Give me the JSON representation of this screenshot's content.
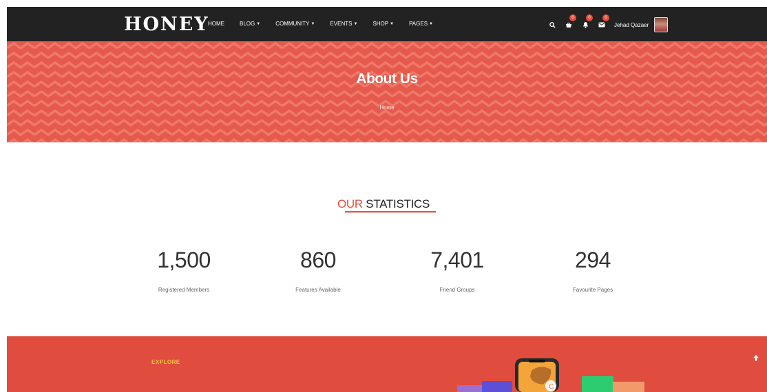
{
  "navbar": {
    "logo": "HONEY",
    "menu": [
      {
        "label": "HOME",
        "dropdown": false
      },
      {
        "label": "BLOG",
        "dropdown": true
      },
      {
        "label": "COMMUNITY",
        "dropdown": true
      },
      {
        "label": "EVENTS",
        "dropdown": true
      },
      {
        "label": "SHOP",
        "dropdown": true
      },
      {
        "label": "PAGES",
        "dropdown": true
      }
    ],
    "icons": {
      "search": "search-icon",
      "cart": "cart-icon",
      "notifications": "bell-icon",
      "messages": "envelope-icon"
    },
    "badges": {
      "cart": "0",
      "notifications": "0",
      "messages": "0"
    },
    "user_name": "Jehad Qazaer"
  },
  "hero": {
    "title": "About Us",
    "breadcrumb": "Home"
  },
  "stats": {
    "heading_accent": "OUR",
    "heading_rest": " STATISTICS",
    "items": [
      {
        "value": "1,500",
        "label": "Registered Members"
      },
      {
        "value": "860",
        "label": "Features Available"
      },
      {
        "value": "7,401",
        "label": "Friend Groups"
      },
      {
        "value": "294",
        "label": "Favourite Pages"
      }
    ]
  },
  "explore": {
    "label": "EXPLORE"
  },
  "colors": {
    "accent": "#e74c3c",
    "navbar_bg": "#222222",
    "hero_bg": "#e55a4c",
    "explore_label": "#f7c948"
  }
}
